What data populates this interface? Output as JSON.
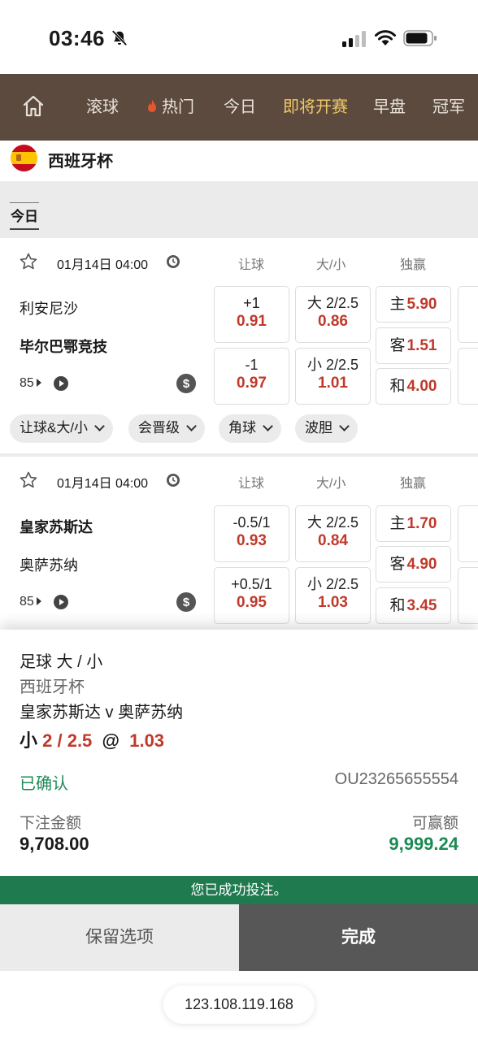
{
  "status_bar": {
    "time": "03:46"
  },
  "nav": {
    "items": [
      {
        "label": "滚球"
      },
      {
        "label": "热门"
      },
      {
        "label": "今日"
      },
      {
        "label": "即将开赛"
      },
      {
        "label": "早盘"
      },
      {
        "label": "冠军"
      }
    ],
    "active_index": 3
  },
  "league": {
    "name": "西班牙杯"
  },
  "day_tab": {
    "label": "今日"
  },
  "columns": {
    "handicap": "让球",
    "over_under": "大/小",
    "moneyline": "独赢"
  },
  "matches": [
    {
      "datetime": "01月14日 04:00",
      "home": "利安尼沙",
      "away": "毕尔巴鄂竞技",
      "more_count": "85",
      "handicap": [
        {
          "line": "+1",
          "odds": "0.91"
        },
        {
          "line": "-1",
          "odds": "0.97"
        }
      ],
      "over_under": [
        {
          "line": "大 2/2.5",
          "odds": "0.86"
        },
        {
          "line": "小 2/2.5",
          "odds": "1.01"
        }
      ],
      "moneyline": [
        {
          "label": "主",
          "odds": "5.90"
        },
        {
          "label": "客",
          "odds": "1.51"
        },
        {
          "label": "和",
          "odds": "4.00"
        }
      ],
      "filters": [
        "让球&大/小",
        "会晋级",
        "角球",
        "波胆"
      ]
    },
    {
      "datetime": "01月14日 04:00",
      "home": "皇家苏斯达",
      "away": "奥萨苏纳",
      "more_count": "85",
      "handicap": [
        {
          "line": "-0.5/1",
          "odds": "0.93"
        },
        {
          "line": "+0.5/1",
          "odds": "0.95"
        }
      ],
      "over_under": [
        {
          "line": "大 2/2.5",
          "odds": "0.84"
        },
        {
          "line": "小 2/2.5",
          "odds": "1.03"
        }
      ],
      "moneyline": [
        {
          "label": "主",
          "odds": "1.70"
        },
        {
          "label": "客",
          "odds": "4.90"
        },
        {
          "label": "和",
          "odds": "3.45"
        }
      ]
    }
  ],
  "bet_slip": {
    "bet_type": "足球 大 / 小",
    "league": "西班牙杯",
    "match": "皇家苏斯达 v 奥萨苏纳",
    "selection": "小",
    "line": "2 / 2.5",
    "at": "@",
    "odds": "1.03",
    "status": "已确认",
    "ticket_id": "OU23265655554",
    "stake_label": "下注金额",
    "stake": "9,708.00",
    "payout_label": "可赢额",
    "payout": "9,999.24",
    "success_msg": "您已成功投注。",
    "keep_button": "保留选项",
    "done_button": "完成"
  },
  "url": "123.108.119.168",
  "colors": {
    "nav_bg": "#5b4a3d",
    "nav_active": "#f0c96a",
    "odds_red": "#c0392b",
    "success_green": "#1f7a50",
    "done_button": "#575757"
  }
}
